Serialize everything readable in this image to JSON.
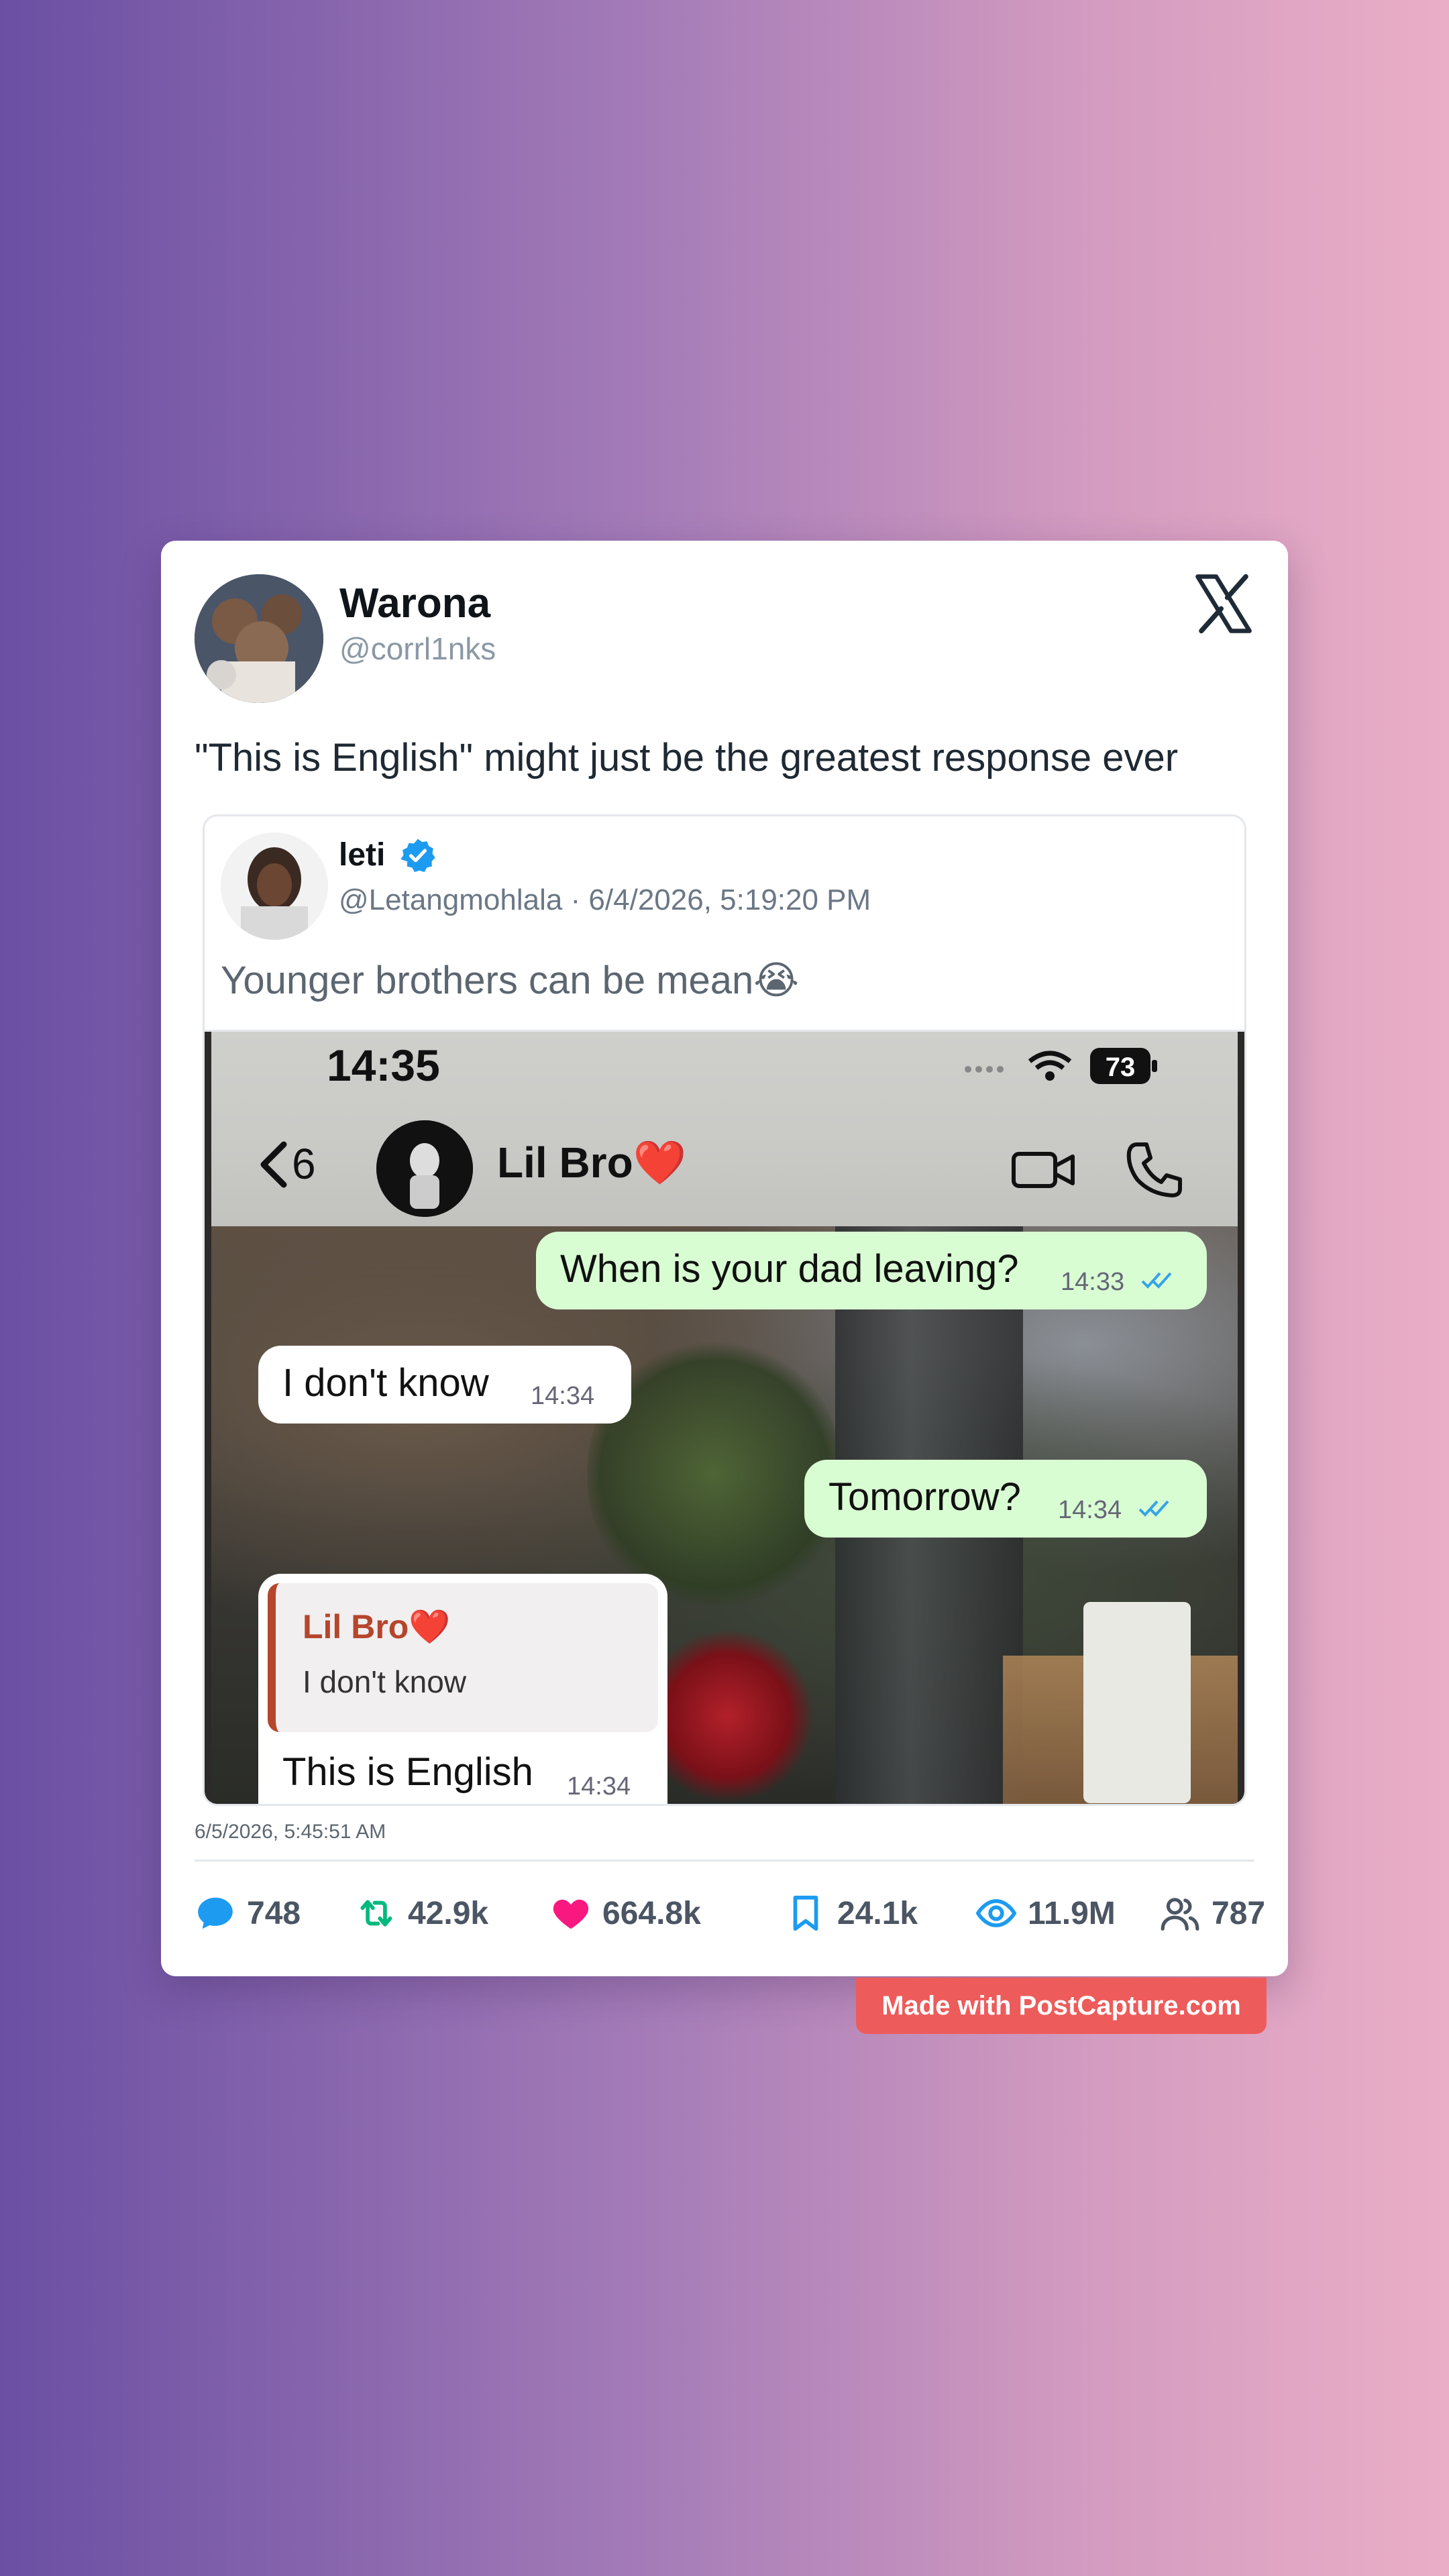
{
  "post": {
    "author_name": "Warona",
    "author_handle": "@corrl1nks",
    "text": "\"This is English\" might just be the greatest response ever",
    "timestamp": "6/5/2026, 5:45:51 AM",
    "platform_icon": "x-logo-icon"
  },
  "quoted": {
    "author_name": "leti",
    "verified_icon": "verified-badge-icon",
    "meta": "@Letangmohlala · 6/4/2026, 5:19:20 PM",
    "text": "Younger brothers can be mean😭"
  },
  "screenshot": {
    "clock": "14:35",
    "battery": "73",
    "back_count": "6",
    "chat_name": "Lil Bro❤️",
    "messages": [
      {
        "dir": "out",
        "text": "When is your dad leaving?",
        "time": "14:33"
      },
      {
        "dir": "in",
        "text": "I don't know",
        "time": "14:34"
      },
      {
        "dir": "out",
        "text": "Tomorrow?",
        "time": "14:34"
      },
      {
        "dir": "in",
        "reply_to_name": "Lil Bro❤️",
        "reply_to_text": "I don't know",
        "text": "This is English",
        "time": "14:34"
      }
    ]
  },
  "stats": {
    "replies": "748",
    "reposts": "42.9k",
    "likes": "664.8k",
    "bookmarks": "24.1k",
    "views": "11.9M",
    "followers": "787"
  },
  "footer": {
    "badge": "Made with PostCapture.com"
  },
  "colors": {
    "like": "#f91880",
    "repost": "#00ba7c",
    "reply": "#1d9bf0",
    "badge": "#ee5b5b",
    "bubble_out": "#d9fdd3"
  }
}
